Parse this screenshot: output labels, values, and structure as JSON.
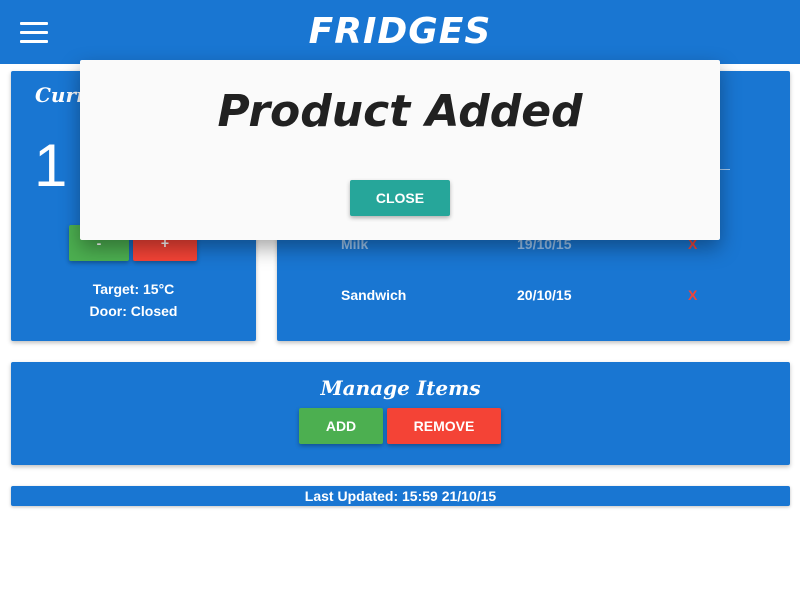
{
  "header": {
    "title": "FRIDGES",
    "menu_icon": "hamburger-menu-icon"
  },
  "temperature_card": {
    "title": "Current Temperature",
    "current_value": "1",
    "decrease_label": "-",
    "increase_label": "+",
    "target": "Target: 15°C",
    "door": "Door: Closed"
  },
  "items": {
    "rows": [
      {
        "name": "Milk",
        "date": "19/10/15",
        "remove_label": "X"
      },
      {
        "name": "Sandwich",
        "date": "20/10/15",
        "remove_label": "X"
      }
    ]
  },
  "manage": {
    "title": "Manage Items",
    "add_label": "ADD",
    "remove_label": "REMOVE"
  },
  "status": {
    "last_updated": "Last Updated: 15:59 21/10/15"
  },
  "dialog": {
    "title": "Product Added",
    "close_label": "CLOSE"
  },
  "colors": {
    "primary": "#1976d2",
    "green": "#4caf50",
    "red": "#f44336",
    "teal": "#26a69a",
    "dialog_bg": "#fafafa"
  }
}
